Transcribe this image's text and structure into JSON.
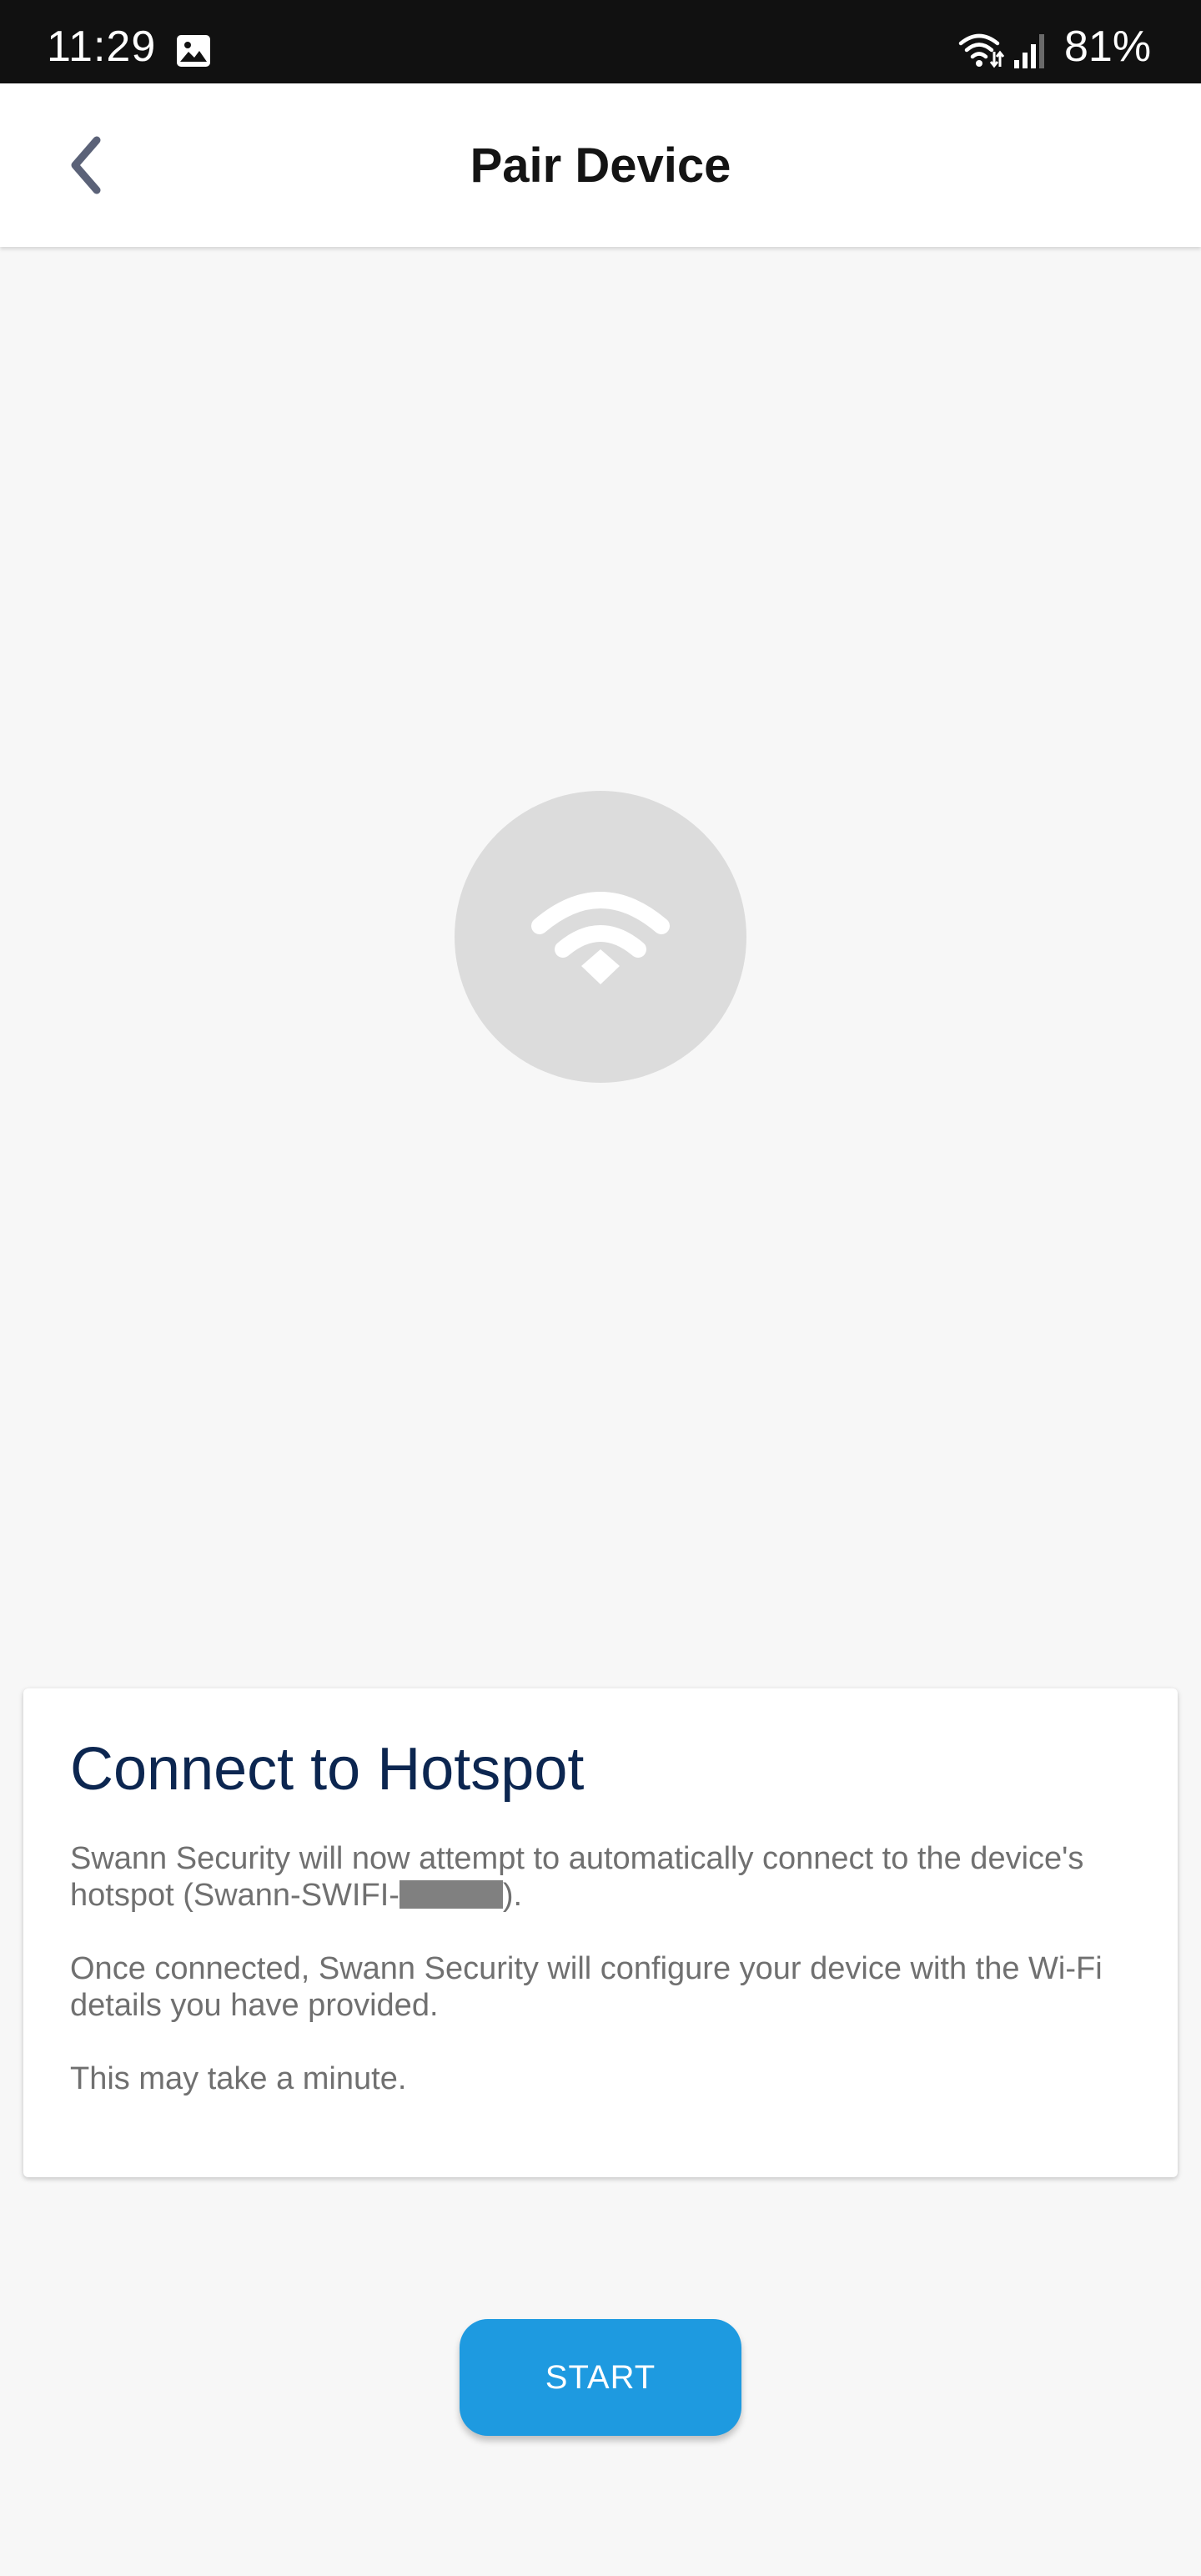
{
  "status_bar": {
    "time": "11:29",
    "battery": "81%",
    "icons": [
      "gallery-icon",
      "wifi-icon",
      "signal-icon"
    ]
  },
  "header": {
    "title": "Pair Device",
    "back_icon": "chevron-left-icon"
  },
  "hero": {
    "icon": "wifi-icon"
  },
  "card": {
    "title": "Connect to Hotspot",
    "para1_prefix": "Swann Security will now attempt to automatically connect to the device's hotspot (Swann-SWIFI-",
    "para1_suffix": ").",
    "para2": "Once connected, Swann Security will configure your device with the Wi-Fi details you have provided.",
    "para3": "This may take a minute."
  },
  "actions": {
    "start_label": "START"
  },
  "colors": {
    "status_bar_bg": "#111111",
    "background": "#f7f7f7",
    "title_navy": "#0c2650",
    "body_gray": "#707070",
    "button_blue": "#1e9ae0",
    "circle_gray": "#dcdcdc",
    "back_icon_slate": "#5b6278"
  }
}
